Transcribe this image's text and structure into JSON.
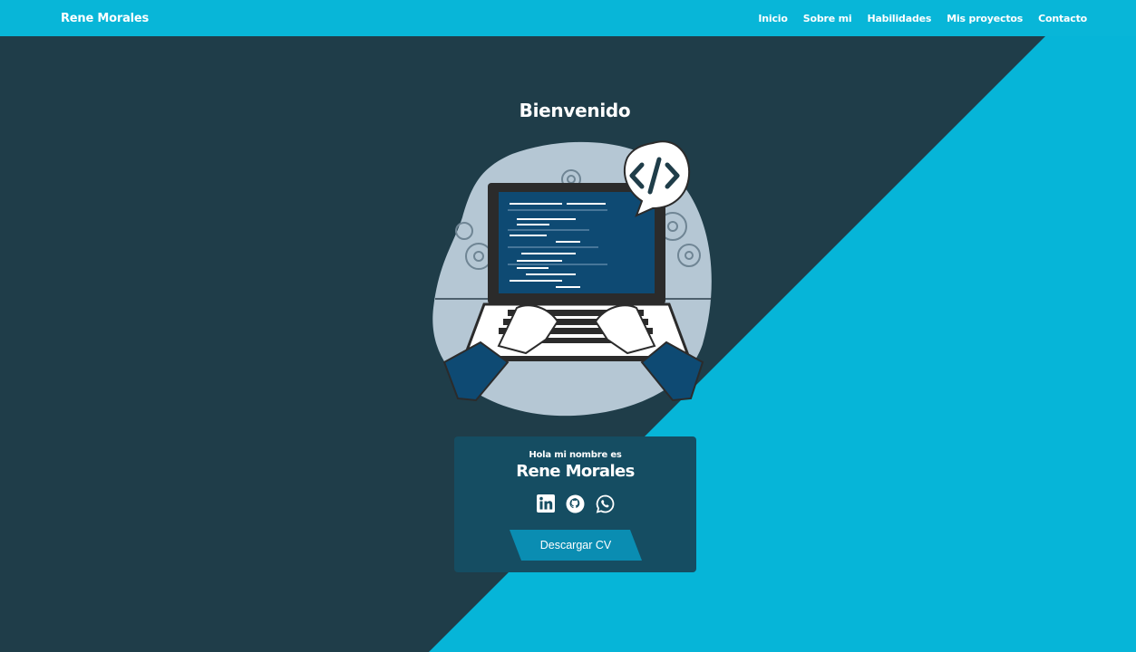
{
  "navbar": {
    "brand": "Rene Morales",
    "links": [
      "Inicio",
      "Sobre mi",
      "Habilidades",
      "Mis proyectos",
      "Contacto"
    ]
  },
  "hero": {
    "title": "Bienvenido"
  },
  "card": {
    "greeting": "Hola mi nombre es",
    "name": "Rene Morales",
    "socials": [
      "linkedin-icon",
      "github-icon",
      "whatsapp-icon"
    ],
    "cv_button": "Descargar CV"
  },
  "colors": {
    "cyan": "#06b5d8",
    "dark_teal": "#1f3d49",
    "card": "#154d62",
    "button": "#0a8db2",
    "code_screen": "#0e4a73",
    "blob": "#b5c7d4"
  }
}
